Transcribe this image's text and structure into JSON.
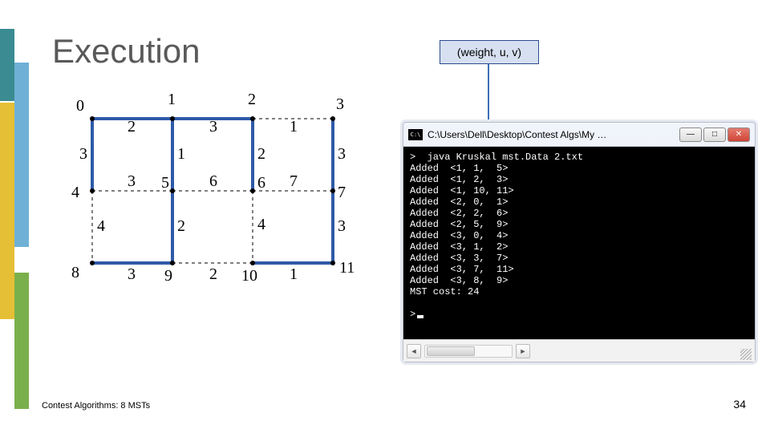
{
  "title": "Execution",
  "callout": "(weight, u, v)",
  "window": {
    "title": "C:\\Users\\Dell\\Desktop\\Contest Algs\\My …",
    "min": "—",
    "max": "□",
    "close": "✕"
  },
  "console": {
    "cmd": ">  java Kruskal mst.Data 2.txt",
    "lines": [
      "Added  <1, 1,  5>",
      "Added  <1, 2,  3>",
      "Added  <1, 10, 11>",
      "Added  <2, 0,  1>",
      "Added  <2, 2,  6>",
      "Added  <2, 5,  9>",
      "Added  <3, 0,  4>",
      "Added  <3, 1,  2>",
      "Added  <3, 3,  7>",
      "Added  <3, 7,  11>",
      "Added  <3, 8,  9>"
    ],
    "cost": "MST cost: 24",
    "prompt": ">"
  },
  "graph": {
    "node_labels": [
      "0",
      "1",
      "2",
      "3",
      "4",
      "5",
      "6",
      "7",
      "8",
      "9",
      "10",
      "11"
    ],
    "edge_weights": {
      "e01": "2",
      "e12": "3",
      "e23": "1",
      "e04": "3",
      "e15": "1",
      "e26": "2",
      "e37": "3",
      "e45": "3",
      "e56": "6",
      "e67": "7",
      "e48": "4",
      "e59": "2",
      "e610": "4",
      "e711": "3",
      "e89": "3",
      "e910": "2",
      "e1011": "1"
    }
  },
  "footer": {
    "left": "Contest Algorithms: 8 MSTs",
    "page": "34"
  },
  "chart_data": {
    "type": "diagram",
    "description": "4x3 grid graph with 12 nodes (0–11) and weighted edges; highlighted edges form the MST found by Kruskal's algorithm.",
    "nodes": [
      {
        "id": 0,
        "x": 0,
        "y": 0
      },
      {
        "id": 1,
        "x": 1,
        "y": 0
      },
      {
        "id": 2,
        "x": 2,
        "y": 0
      },
      {
        "id": 3,
        "x": 3,
        "y": 0
      },
      {
        "id": 4,
        "x": 0,
        "y": 1
      },
      {
        "id": 5,
        "x": 1,
        "y": 1
      },
      {
        "id": 6,
        "x": 2,
        "y": 1
      },
      {
        "id": 7,
        "x": 3,
        "y": 1
      },
      {
        "id": 8,
        "x": 0,
        "y": 2
      },
      {
        "id": 9,
        "x": 1,
        "y": 2
      },
      {
        "id": 10,
        "x": 2,
        "y": 2
      },
      {
        "id": 11,
        "x": 3,
        "y": 2
      }
    ],
    "edges": [
      {
        "u": 0,
        "v": 1,
        "w": 2,
        "mst": true
      },
      {
        "u": 1,
        "v": 2,
        "w": 3,
        "mst": true
      },
      {
        "u": 2,
        "v": 3,
        "w": 1,
        "mst": false
      },
      {
        "u": 0,
        "v": 4,
        "w": 3,
        "mst": true
      },
      {
        "u": 1,
        "v": 5,
        "w": 1,
        "mst": true
      },
      {
        "u": 2,
        "v": 6,
        "w": 2,
        "mst": true
      },
      {
        "u": 3,
        "v": 7,
        "w": 3,
        "mst": true
      },
      {
        "u": 4,
        "v": 5,
        "w": 3,
        "mst": false
      },
      {
        "u": 5,
        "v": 6,
        "w": 6,
        "mst": false
      },
      {
        "u": 6,
        "v": 7,
        "w": 7,
        "mst": false
      },
      {
        "u": 4,
        "v": 8,
        "w": 4,
        "mst": false
      },
      {
        "u": 5,
        "v": 9,
        "w": 2,
        "mst": true
      },
      {
        "u": 6,
        "v": 10,
        "w": 4,
        "mst": false
      },
      {
        "u": 7,
        "v": 11,
        "w": 3,
        "mst": true
      },
      {
        "u": 8,
        "v": 9,
        "w": 3,
        "mst": true
      },
      {
        "u": 9,
        "v": 10,
        "w": 2,
        "mst": false
      },
      {
        "u": 10,
        "v": 11,
        "w": 1,
        "mst": true
      }
    ],
    "mst_cost": 24
  }
}
